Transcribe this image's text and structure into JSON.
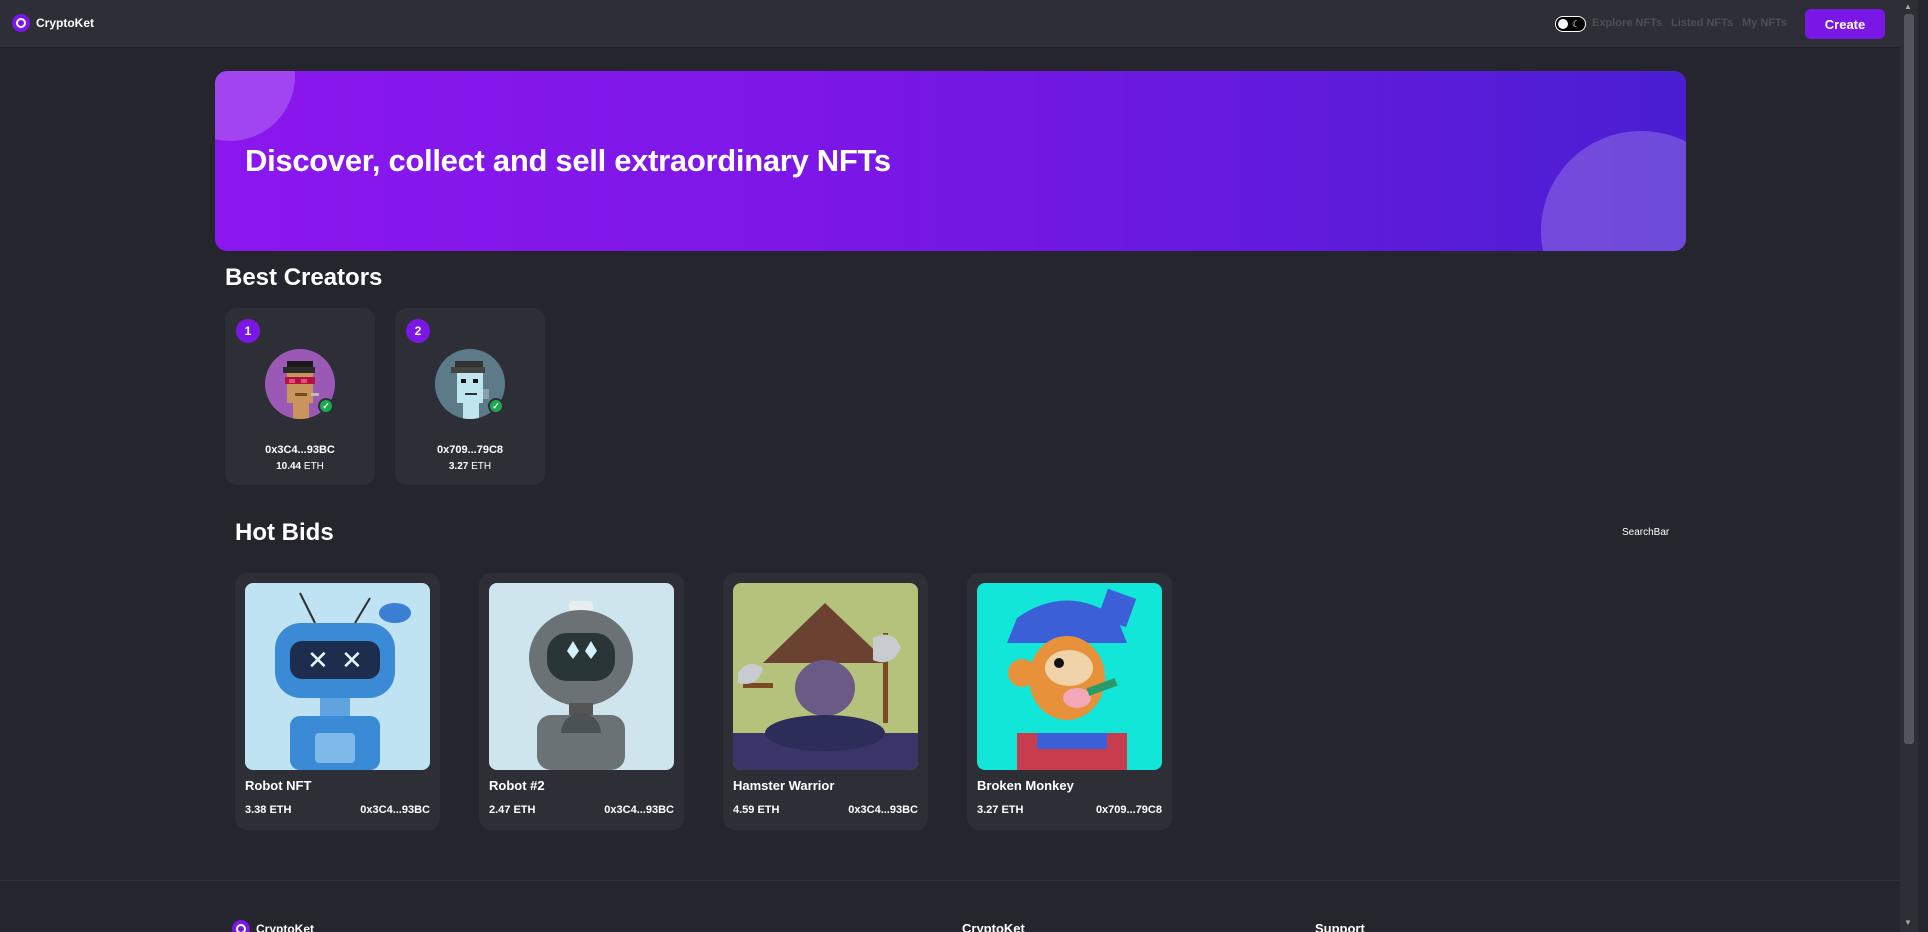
{
  "navbar": {
    "brand_name": "CryptoKet",
    "links": [
      "Explore NFTs",
      "Listed NFTs",
      "My NFTs"
    ],
    "create_label": "Create",
    "toggle_icon": "moon-icon"
  },
  "banner": {
    "title": "Discover, collect and sell extraordinary NFTs",
    "gradient_colors": [
      "#8b17ee",
      "#4a1ed2"
    ]
  },
  "best_creators": {
    "title": "Best Creators",
    "items": [
      {
        "rank": "1",
        "address": "0x3C4...93BC",
        "amount": "10.44",
        "unit": "ETH"
      },
      {
        "rank": "2",
        "address": "0x709...79C8",
        "amount": "3.27",
        "unit": "ETH"
      }
    ]
  },
  "hot_bids": {
    "title": "Hot Bids",
    "search_label": "SearchBar",
    "items": [
      {
        "name": "Robot NFT",
        "price": "3.38 ETH",
        "owner": "0x3C4...93BC"
      },
      {
        "name": "Robot #2",
        "price": "2.47 ETH",
        "owner": "0x3C4...93BC"
      },
      {
        "name": "Hamster Warrior",
        "price": "4.59 ETH",
        "owner": "0x3C4...93BC"
      },
      {
        "name": "Broken Monkey",
        "price": "3.27 ETH",
        "owner": "0x709...79C8"
      }
    ]
  },
  "footer": {
    "brand_name": "CryptoKet",
    "columns": [
      "CryptoKet",
      "Support"
    ]
  },
  "colors": {
    "accent": "#7a17e6",
    "background": "#24252d",
    "card": "#2d2e36",
    "verified": "#1aa94f"
  }
}
